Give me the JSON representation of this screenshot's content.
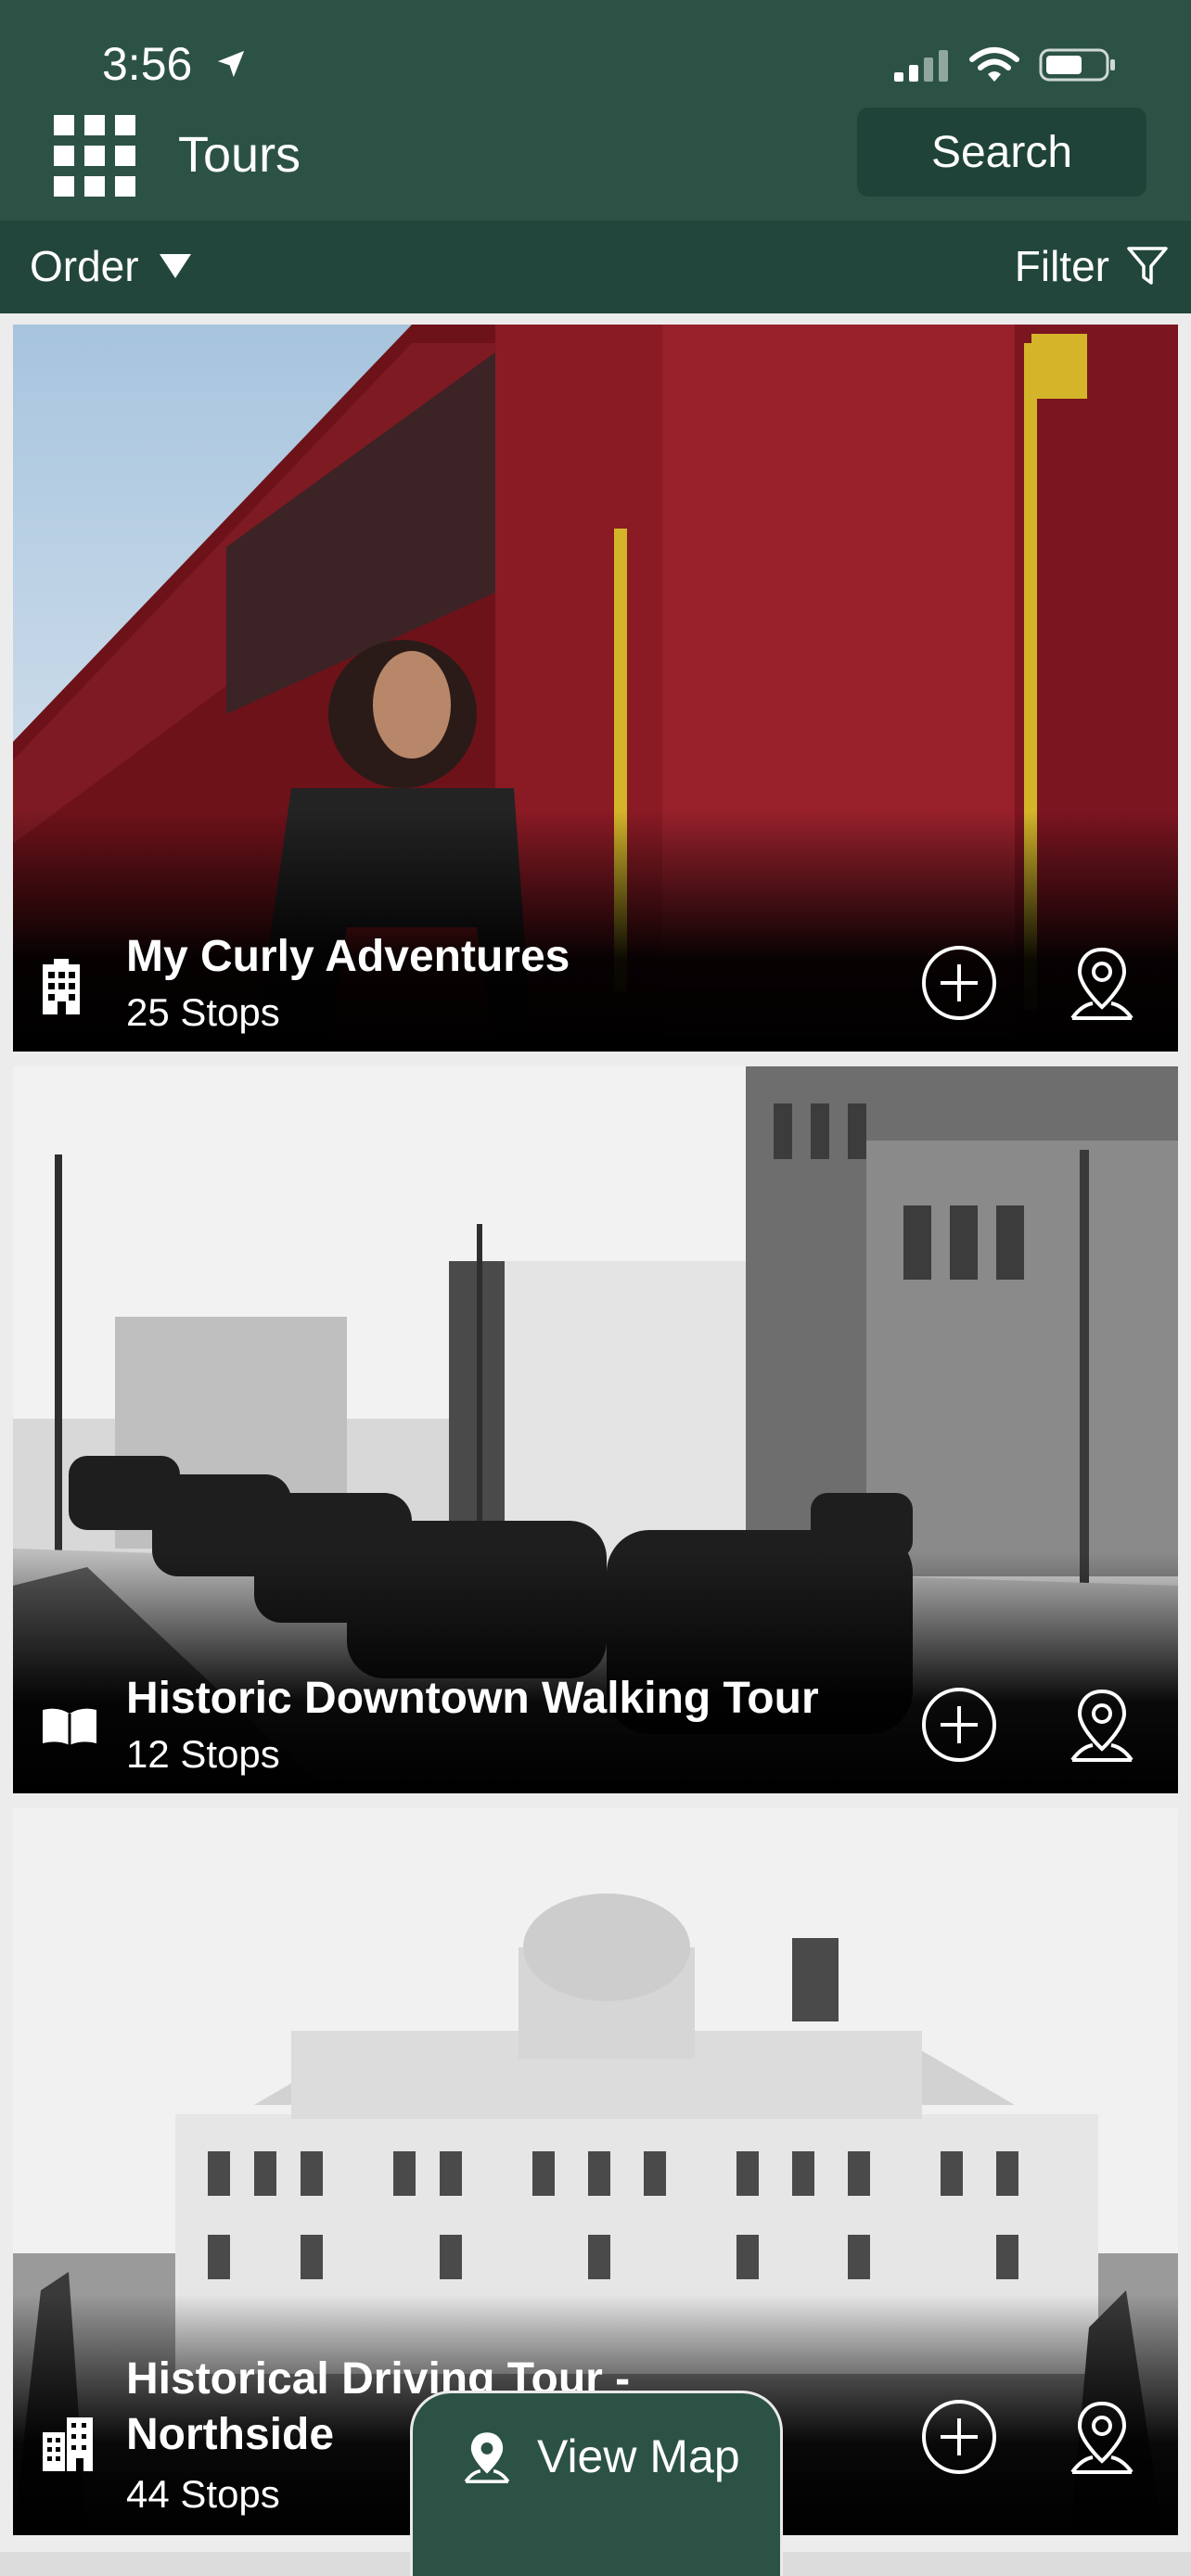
{
  "status": {
    "time": "3:56"
  },
  "header": {
    "title": "Tours",
    "search_label": "Search"
  },
  "toolbar": {
    "order_label": "Order",
    "filter_label": "Filter"
  },
  "tours": [
    {
      "name": "My Curly Adventures",
      "stops": "25 Stops",
      "icon": "building-icon"
    },
    {
      "name": "Historic Downtown Walking Tour",
      "stops": "12 Stops",
      "icon": "book-icon"
    },
    {
      "name": "Historical Driving Tour -",
      "name2": "Northside",
      "stops": "44 Stops",
      "icon": "buildings-icon"
    }
  ],
  "view_map": {
    "label": "View Map"
  },
  "colors": {
    "header": "#2c5246",
    "filter_bar": "#22463b",
    "search_bg": "#1f4338",
    "train_red": "#8a1a24"
  }
}
